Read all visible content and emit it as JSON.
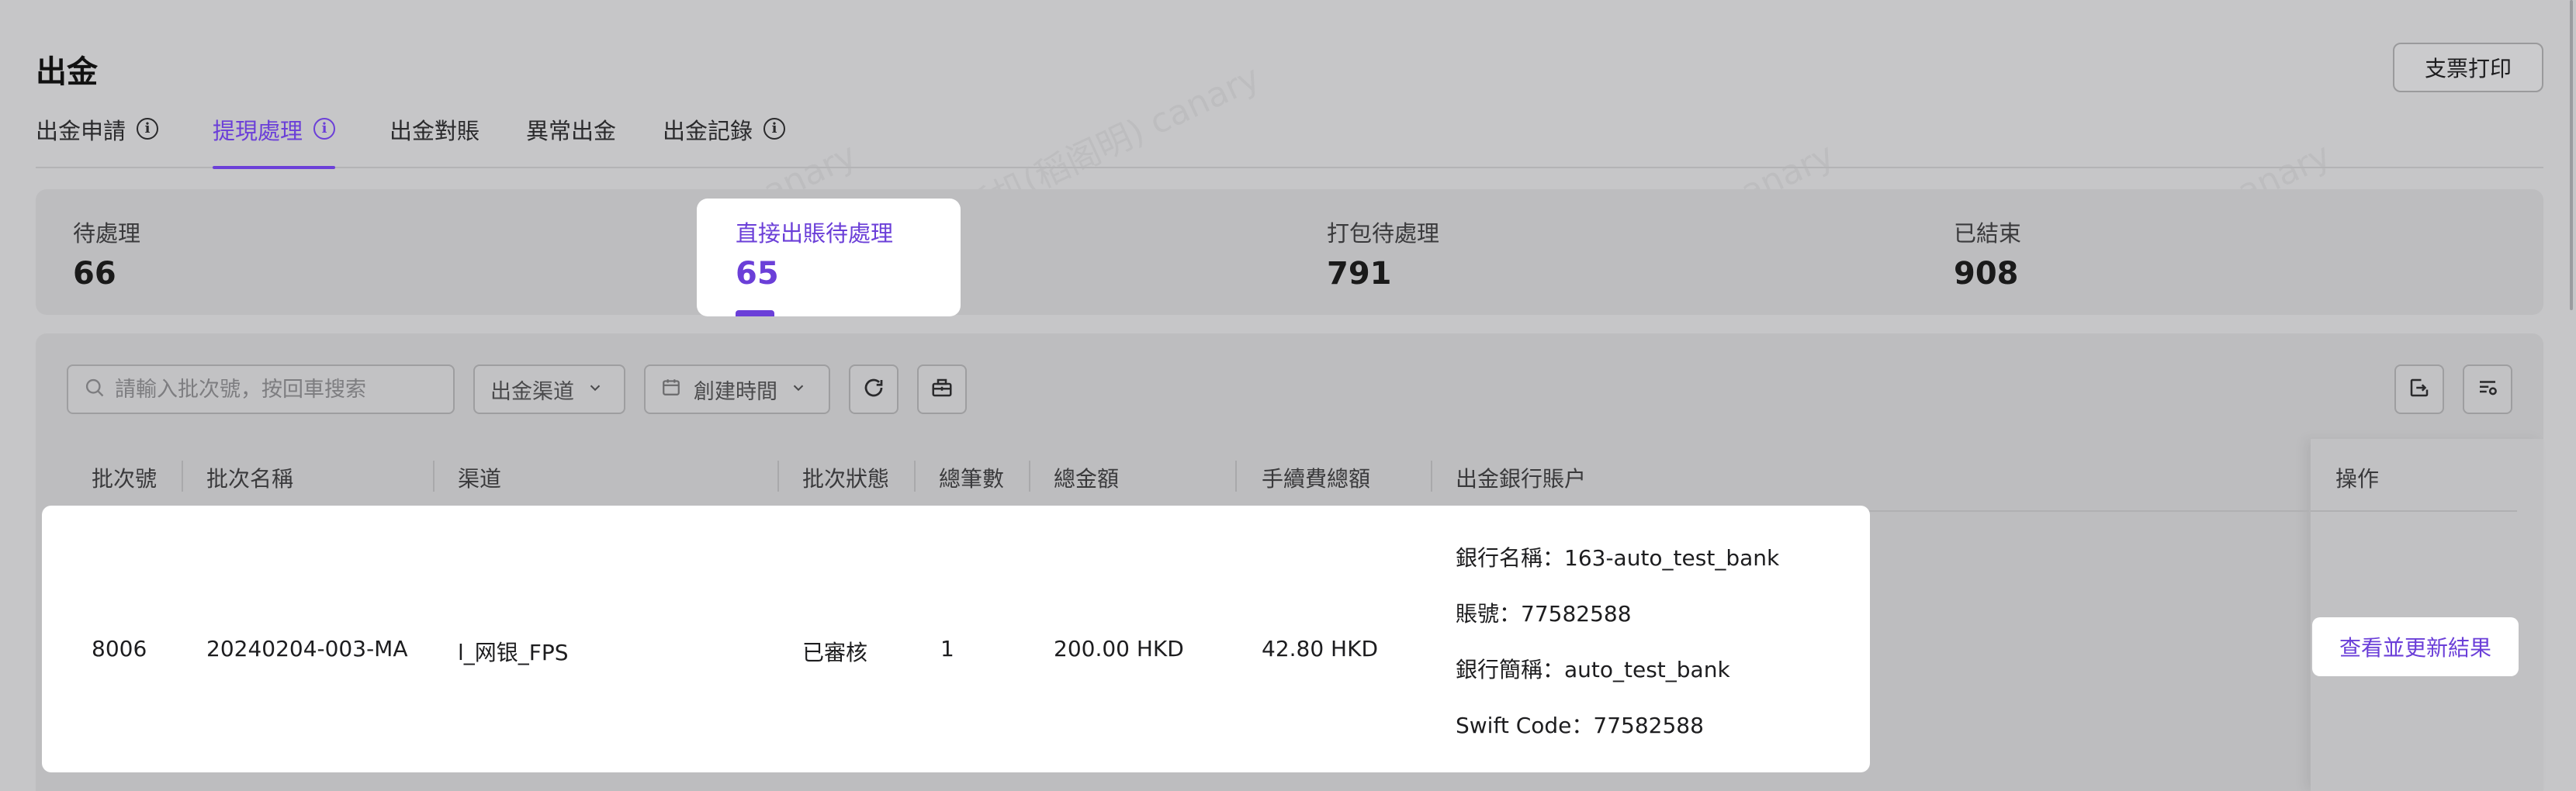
{
  "page": {
    "title": "出金",
    "print_button": "支票打印"
  },
  "tabs": [
    {
      "label": "出金申請",
      "info": true,
      "active": false
    },
    {
      "label": "提現處理",
      "info": true,
      "active": true
    },
    {
      "label": "出金對賬",
      "info": false,
      "active": false
    },
    {
      "label": "異常出金",
      "info": false,
      "active": false
    },
    {
      "label": "出金記錄",
      "info": true,
      "active": false
    }
  ],
  "stats": [
    {
      "label": "待處理",
      "value": "66"
    },
    {
      "label": "直接出賬待處理",
      "value": "65",
      "active": true
    },
    {
      "label": "打包待處理",
      "value": "791"
    },
    {
      "label": "已結束",
      "value": "908"
    }
  ],
  "filters": {
    "search_placeholder": "請輸入批次號，按回車搜索",
    "channel_select": "出金渠道",
    "date_select": "創建時間"
  },
  "icons": {
    "search": "search-icon",
    "chevron": "chevron-down-icon",
    "calendar": "calendar-icon",
    "refresh": "refresh-icon",
    "package": "package-icon",
    "export": "export-icon",
    "column_settings": "column-settings-icon"
  },
  "table": {
    "headers": [
      "批次號",
      "批次名稱",
      "渠道",
      "批次狀態",
      "總筆數",
      "總金額",
      "手續費總額",
      "出金銀行賬户",
      "操作"
    ],
    "rows": [
      {
        "batch_no": "8006",
        "batch_name": "20240204-003-MA",
        "channel": "l_网银_FPS",
        "status": "已審核",
        "count": "1",
        "total": "200.00 HKD",
        "fee": "42.80 HKD",
        "bank_lines": [
          "銀行名稱：163-auto_test_bank",
          "賬號：77582588",
          "銀行簡稱：auto_test_bank",
          "Swift Code：77582588"
        ],
        "action": "查看並更新結果"
      }
    ]
  },
  "colors": {
    "accent": "#6b3fd8",
    "overlay": "#c6c6c8",
    "highlight": "#ffffff"
  }
}
